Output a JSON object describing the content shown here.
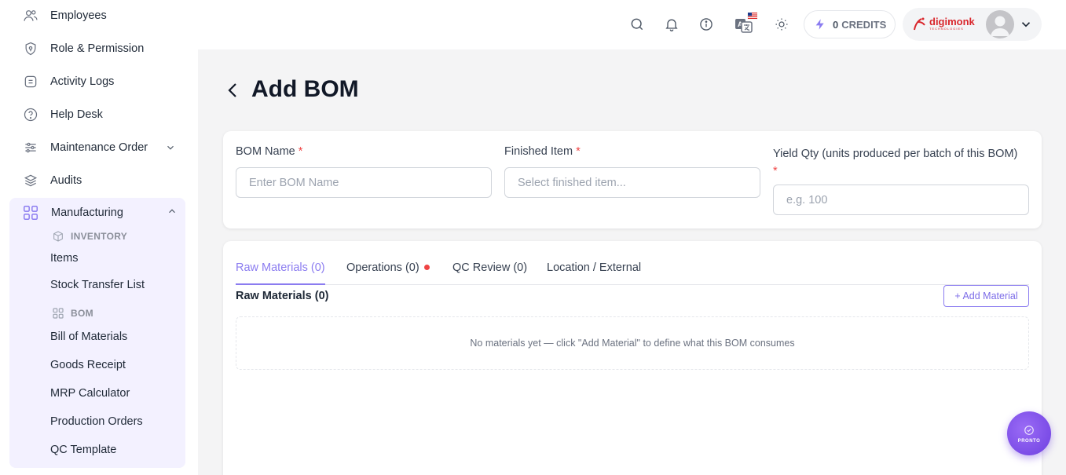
{
  "sidebar": {
    "items": [
      {
        "label": "Employees",
        "icon": "users-icon"
      },
      {
        "label": "Role & Permission",
        "icon": "shield-icon"
      },
      {
        "label": "Activity Logs",
        "icon": "list-icon"
      },
      {
        "label": "Help Desk",
        "icon": "help-circle-icon"
      },
      {
        "label": "Maintenance Order",
        "icon": "sliders-icon"
      },
      {
        "label": "Audits",
        "icon": "layers-icon"
      }
    ],
    "manufacturing": {
      "label": "Manufacturing",
      "inventory_heading": "INVENTORY",
      "inventory_items": [
        "Items",
        "Stock Transfer List"
      ],
      "bom_heading": "BOM",
      "bom_items": [
        "Bill of Materials",
        "Goods Receipt",
        "MRP Calculator",
        "Production Orders",
        "QC Template"
      ]
    }
  },
  "topbar": {
    "credits_value": "0",
    "credits_label": "CREDITS",
    "brand": "digimonk",
    "brand_sub": "TECHNOLOGIES"
  },
  "page": {
    "title": "Add BOM",
    "bom_name": {
      "label": "BOM Name",
      "required": "*",
      "placeholder": "Enter BOM Name",
      "value": ""
    },
    "finished_item": {
      "label": "Finished Item",
      "required": "*",
      "placeholder": "Select finished item..."
    },
    "yield_qty": {
      "label": "Yield Qty (units produced per batch of this BOM)",
      "required": "*",
      "placeholder": "e.g. 100",
      "value": ""
    },
    "tabs": [
      {
        "label": "Raw Materials (0)",
        "active": true
      },
      {
        "label": "Operations (0)",
        "active": false
      },
      {
        "label": "QC Review (0)",
        "active": false
      },
      {
        "label": "Location / External",
        "active": false
      }
    ],
    "section_title": "Raw Materials (0)",
    "add_material_label": "+ Add Material",
    "empty_message": "No materials yet — click \"Add Material\" to define what this BOM consumes"
  },
  "fab": {
    "label": "PRONTO"
  },
  "colors": {
    "accent": "#8b7cf0",
    "required": "#ef4444",
    "brand": "#d9262c"
  }
}
